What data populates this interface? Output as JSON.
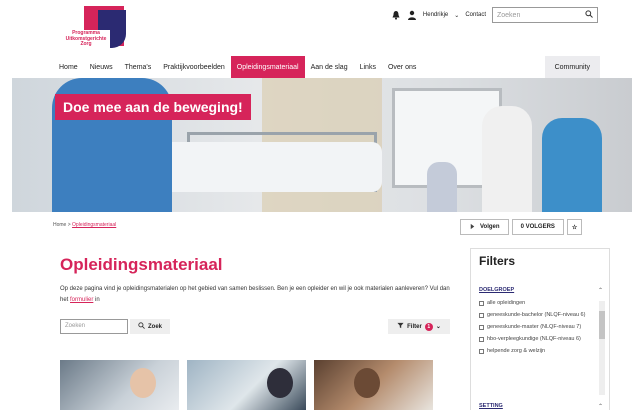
{
  "logo": {
    "text": "Programma Uitkomstgerichte Zorg"
  },
  "topbar": {
    "user": "Hendrikje",
    "contact": "Contact",
    "search_placeholder": "Zoeken"
  },
  "nav": {
    "items": [
      "Home",
      "Nieuws",
      "Thema's",
      "Praktijkvoorbeelden",
      "Opleidingsmateriaal",
      "Aan de slag",
      "Links",
      "Over ons"
    ],
    "active": "Opleidingsmateriaal",
    "community": "Community"
  },
  "hero": {
    "badge": "Doe mee aan de beweging!"
  },
  "breadcrumb": {
    "home": "Home",
    "separator": ">",
    "current": "Opleidingsmateriaal"
  },
  "follow": {
    "label": "Volgen",
    "count": "0 VOLGERS"
  },
  "main": {
    "title": "Opleidingsmateriaal",
    "intro_before": "Op deze pagina vind je opleidingsmaterialen op het gebied van samen beslissen. Ben je een opleider en wil je ook materialen aanleveren? Vul dan het",
    "intro_link": "formulier",
    "intro_after": "in",
    "search_placeholder": "Zoeken",
    "search_button": "Zoek",
    "filter_button": "Filter",
    "filter_count": "1"
  },
  "filters": {
    "title": "Filters",
    "group1": "DOELGROEP",
    "group2": "SETTING",
    "options": [
      "alle opleidingen",
      "geneeskunde-bachelor (NLQF-niveau 6)",
      "geneeskunde-master (NLQF-niveau 7)",
      "hbo-verpleegkundige (NLQF-niveau 6)",
      "helpende zorg & welzijn"
    ]
  },
  "colors": {
    "accent": "#d6245a",
    "brand_dark": "#2b2a72"
  }
}
